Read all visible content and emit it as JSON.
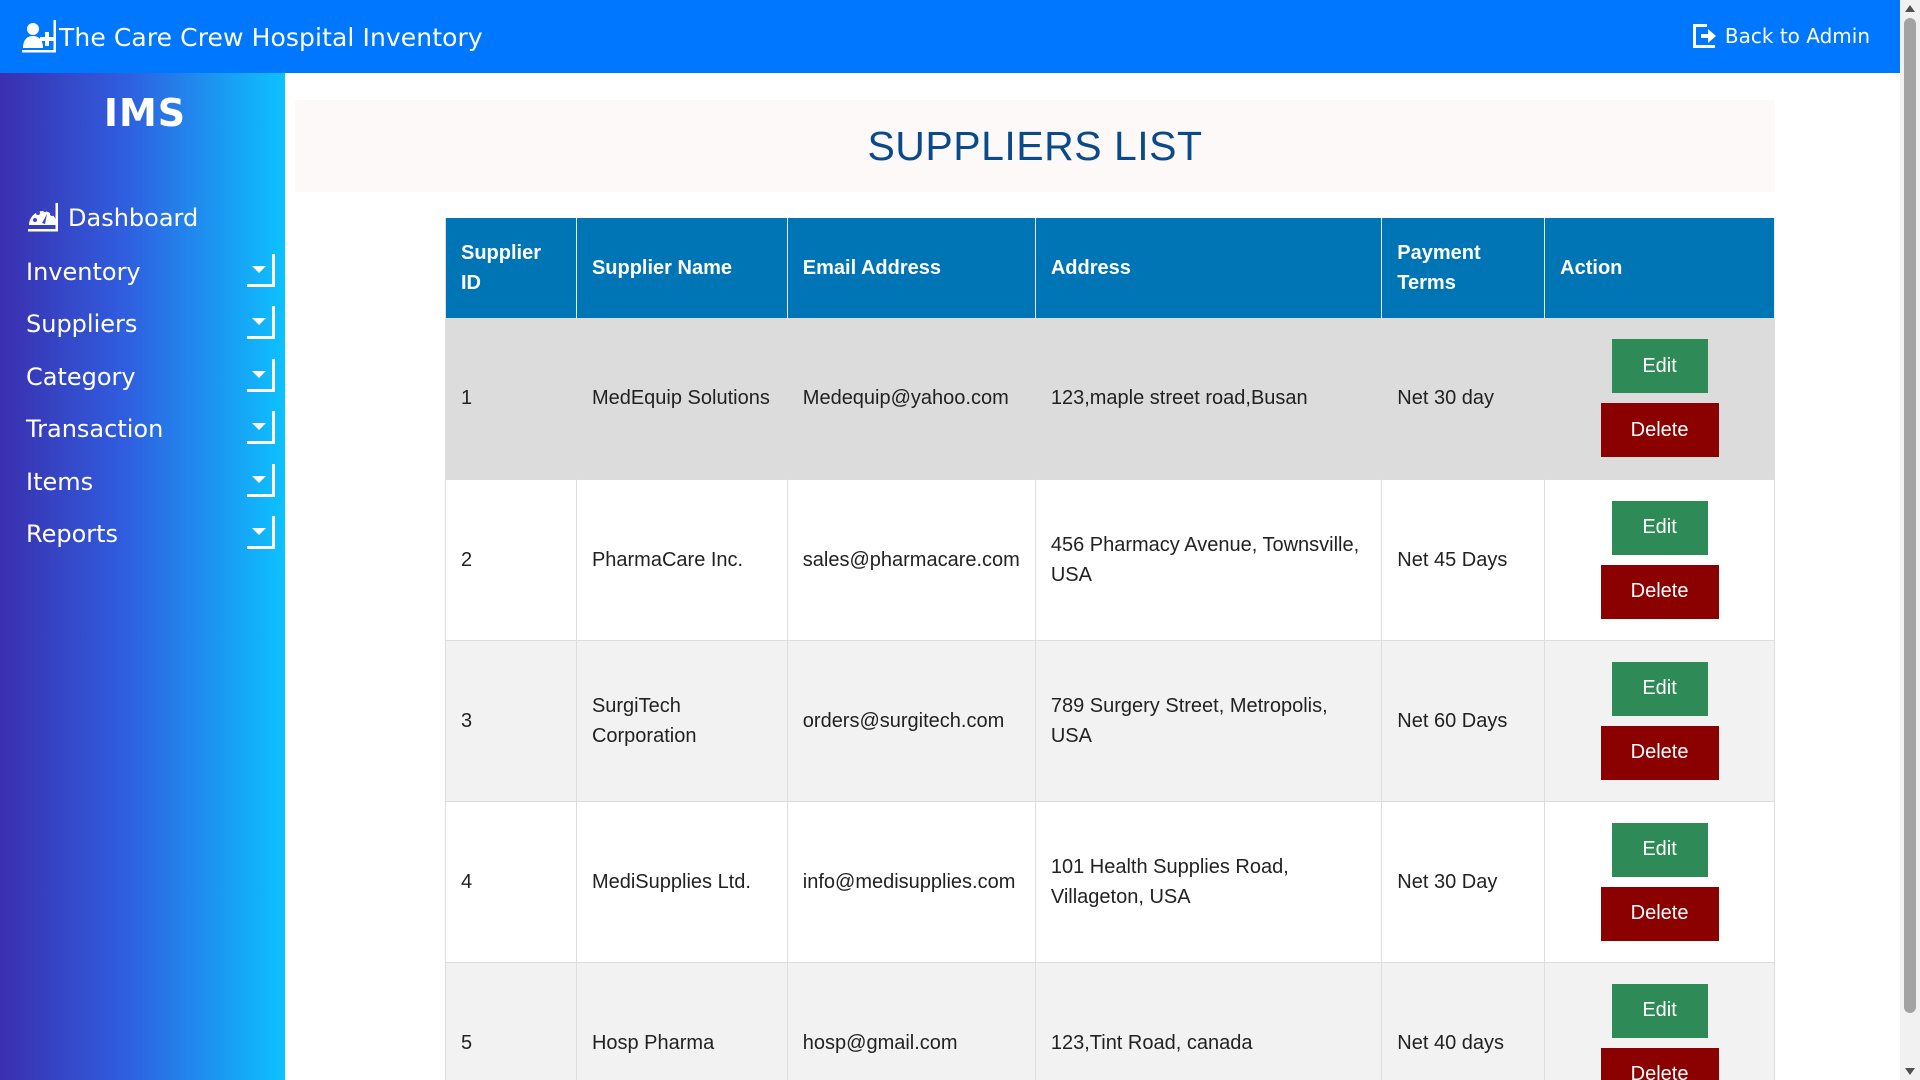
{
  "app": {
    "title": "The Care Crew Hospital Inventory",
    "back_label": "Back to Admin"
  },
  "sidebar": {
    "logo": "IMS",
    "items": [
      {
        "label": "Dashboard",
        "icon": "dashboard-gauge-icon"
      },
      {
        "label": "Inventory",
        "icon": "caret-down-icon"
      },
      {
        "label": "Suppliers",
        "icon": "caret-down-icon"
      },
      {
        "label": "Category",
        "icon": "caret-down-icon"
      },
      {
        "label": "Transaction",
        "icon": "caret-down-icon"
      },
      {
        "label": "Items",
        "icon": "caret-down-icon"
      },
      {
        "label": "Reports",
        "icon": "caret-down-icon"
      }
    ]
  },
  "page": {
    "heading": "SUPPLIERS LIST"
  },
  "table": {
    "headers": [
      "Supplier ID",
      "Supplier Name",
      "Email Address",
      "Address",
      "Payment Terms",
      "Action"
    ],
    "edit_label": "Edit",
    "delete_label": "Delete",
    "rows": [
      {
        "id": "1",
        "name": "MedEquip Solutions",
        "email": "Medequip@yahoo.com",
        "address": "123,maple street road,Busan",
        "terms": "Net 30 day"
      },
      {
        "id": "2",
        "name": "PharmaCare Inc.",
        "email": "sales@pharmacare.com",
        "address": "456 Pharmacy Avenue, Townsville, USA",
        "terms": "Net 45 Days"
      },
      {
        "id": "3",
        "name": "SurgiTech Corporation",
        "email": "orders@surgitech.com",
        "address": "789 Surgery Street, Metropolis, USA",
        "terms": "Net 60 Days"
      },
      {
        "id": "4",
        "name": "MediSupplies Ltd.",
        "email": "info@medisupplies.com",
        "address": "101 Health Supplies Road, Villageton, USA",
        "terms": "Net 30 Day"
      },
      {
        "id": "5",
        "name": "Hosp Pharma",
        "email": "hosp@gmail.com",
        "address": "123,Tint Road, canada",
        "terms": "Net 40 days"
      }
    ]
  },
  "colors": {
    "topbar": "#0077ff",
    "table_header": "#0075b6",
    "edit_button": "#2e8b57",
    "delete_button": "#8b0000",
    "heading_text": "#0b4a8a"
  }
}
